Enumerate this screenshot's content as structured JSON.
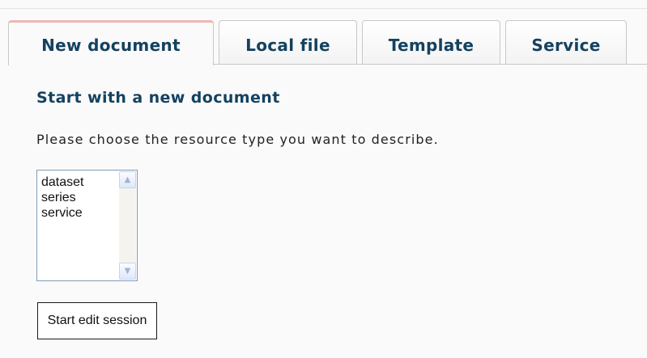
{
  "tabs": [
    {
      "label": "New document",
      "active": true
    },
    {
      "label": "Local file",
      "active": false
    },
    {
      "label": "Template",
      "active": false
    },
    {
      "label": "Service",
      "active": false
    }
  ],
  "main": {
    "heading": "Start with a new document",
    "instruction": "Please choose the resource type you want to describe.",
    "resource_types": [
      "dataset",
      "series",
      "service"
    ],
    "scroll_up_icon": "arrow-up-icon",
    "scroll_down_icon": "arrow-down-icon",
    "start_button_label": "Start edit session"
  },
  "colors": {
    "heading": "#14425f",
    "active_tab_accent": "#f0b6b0",
    "listbox_border": "#7f9db9"
  }
}
